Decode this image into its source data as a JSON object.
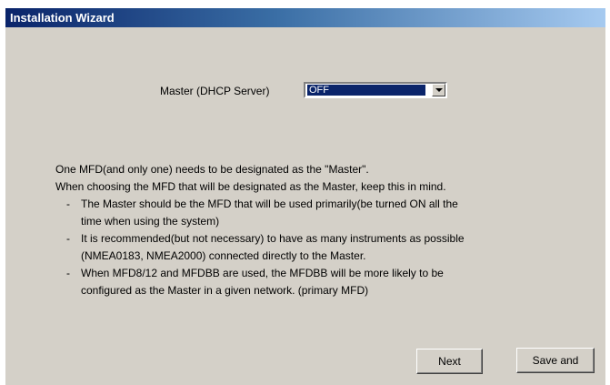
{
  "window": {
    "title": "Installation Wizard"
  },
  "master_setting": {
    "label": "Master (DHCP Server)",
    "value": "OFF"
  },
  "description": {
    "intro_lines": [
      "One MFD(and only one) needs to be designated as the \"Master\".",
      "When choosing the MFD that will be designated as the Master, keep this in mind."
    ],
    "bullets": [
      {
        "dash": "-",
        "lines": [
          "The Master should be the MFD that will be used primarily(be turned ON all the",
          "time when using the system)"
        ]
      },
      {
        "dash": "-",
        "lines": [
          "It is recommended(but not necessary) to have as many instruments as possible",
          "(NMEA0183, NMEA2000) connected directly to the Master."
        ]
      },
      {
        "dash": "-",
        "lines": [
          "When MFD8/12 and MFDBB are used, the MFDBB will be more likely to be",
          "configured as the Master in a given network. (primary MFD)"
        ]
      }
    ]
  },
  "buttons": {
    "next_label": "Next",
    "save_label": "Save and"
  },
  "icons": {
    "dropdown": "chevron-down-icon"
  },
  "colors": {
    "title_bar": "#0a246a",
    "dialog_face": "#d4d0c8",
    "selection": "#0a246a"
  }
}
